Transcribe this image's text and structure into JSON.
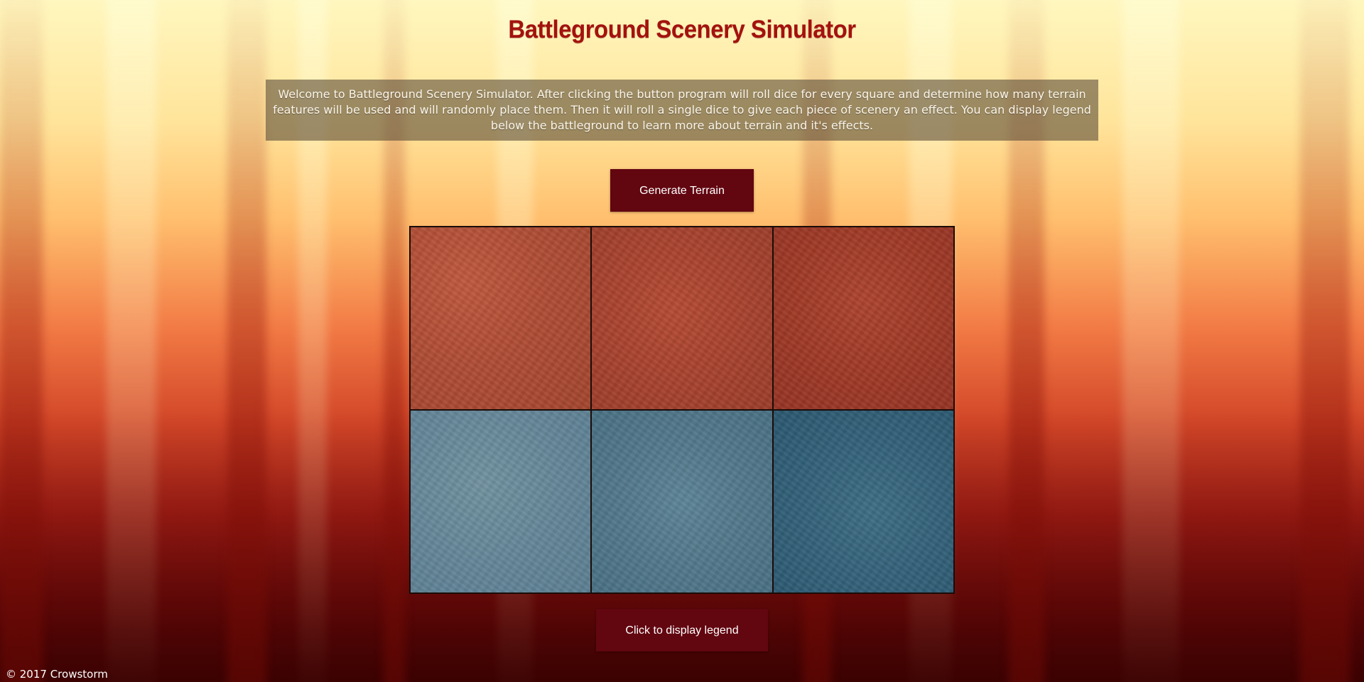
{
  "page": {
    "title": "Battleground Scenery Simulator",
    "intro": "Welcome to Battleground Scenery Simulator. After clicking the button program will roll dice for every square and determine how many terrain features will be used and will randomly place them. Then it will roll a single dice to give each piece of scenery an effect. You can display legend below the battleground to learn more about terrain and it's effects."
  },
  "buttons": {
    "generate_label": "Generate Terrain",
    "legend_label": "Click to display legend"
  },
  "battleground": {
    "rows": 2,
    "columns": 3,
    "tiles": [
      {
        "terrain": "red-desert"
      },
      {
        "terrain": "red-desert"
      },
      {
        "terrain": "red-desert"
      },
      {
        "terrain": "blue-plain"
      },
      {
        "terrain": "blue-plain"
      },
      {
        "terrain": "blue-plain"
      }
    ]
  },
  "footer": {
    "copyright": "© 2017 Crowstorm"
  },
  "colors": {
    "title": "#a3120e",
    "button_bg": "#620610",
    "button_text": "#ffffff",
    "intro_bg": "rgba(95,80,60,0.62)"
  }
}
